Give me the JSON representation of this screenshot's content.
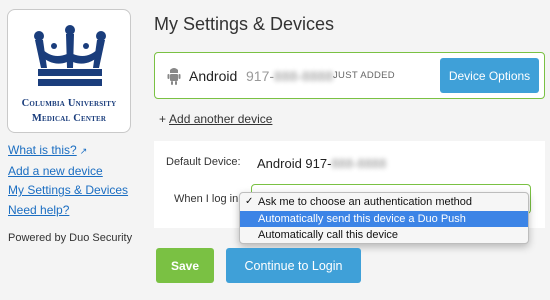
{
  "sidebar": {
    "logo": {
      "line1": "Columbia University",
      "line2": "Medical Center",
      "brand_color": "#1a3d7c"
    },
    "links": [
      {
        "label": "What is this?",
        "icon": "external-link-icon"
      },
      {
        "label": "Add a new device"
      },
      {
        "label": "My Settings & Devices"
      },
      {
        "label": "Need help?"
      }
    ],
    "powered_by": "Powered by Duo Security"
  },
  "main": {
    "title": "My Settings & Devices",
    "device": {
      "icon": "android-icon",
      "name": "Android",
      "number_prefix": "917-",
      "number_hidden": "888-8888",
      "status": "JUST ADDED",
      "options_label": "Device Options"
    },
    "add_another": {
      "plus": "+",
      "label": "Add another device"
    },
    "default_device": {
      "label": "Default Device:",
      "value_prefix": "Android 917-",
      "value_hidden": "888-8888"
    },
    "when_login": {
      "label": "When I log in:",
      "options": [
        {
          "label": "Ask me to choose an authentication method",
          "checked": true
        },
        {
          "label": "Automatically send this device a Duo Push",
          "highlighted": true
        },
        {
          "label": "Automatically call this device"
        }
      ]
    },
    "save_label": "Save",
    "continue_label": "Continue to Login"
  },
  "colors": {
    "accent_blue": "#3fa0d8",
    "accent_green": "#7ac143",
    "link": "#1b6ec2",
    "highlight": "#3c84e6"
  }
}
